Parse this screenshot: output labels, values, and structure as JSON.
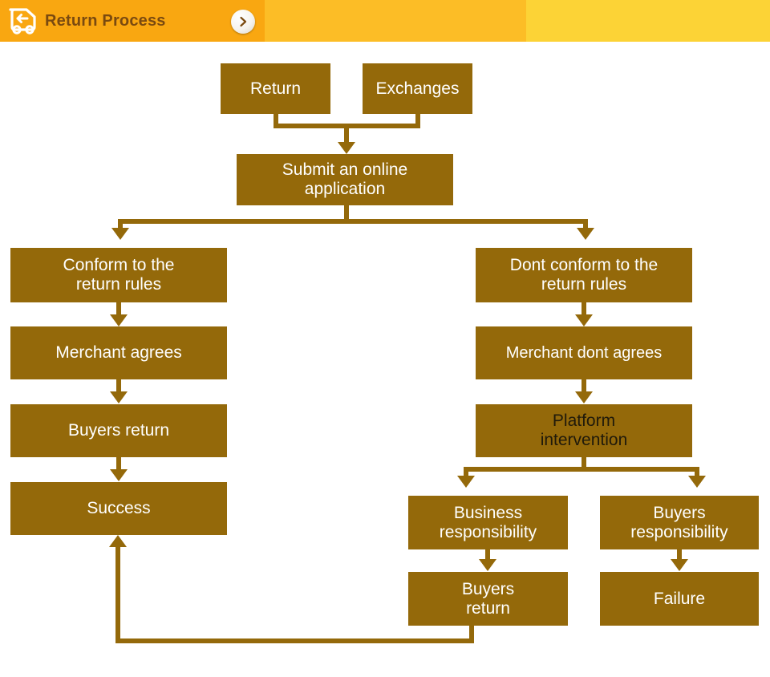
{
  "header": {
    "title": "Return Process",
    "truck_icon": "return-truck-icon",
    "chevron_icon": "chevron-right-icon",
    "band_colors": [
      "#F9A711",
      "#FCBD26",
      "#FCD336"
    ],
    "title_color": "#7A4A10"
  },
  "theme": {
    "node_fill": "#94690A",
    "node_text": "#FFFFFF",
    "node_text_dark": "#201A0A",
    "connector": "#94690A",
    "background": "#FFFFFF"
  },
  "flow": {
    "nodes": [
      {
        "id": "return",
        "label": "Return"
      },
      {
        "id": "exchanges",
        "label": "Exchanges"
      },
      {
        "id": "submit",
        "label": "Submit an online\napplication"
      },
      {
        "id": "conform",
        "label": "Conform to the\nreturn rules"
      },
      {
        "id": "merchant-agrees",
        "label": "Merchant agrees"
      },
      {
        "id": "buyers-return-left",
        "label": "Buyers return"
      },
      {
        "id": "success",
        "label": "Success"
      },
      {
        "id": "dont-conform",
        "label": "Dont conform to the\nreturn rules"
      },
      {
        "id": "merchant-dont-agrees",
        "label": "Merchant dont agrees"
      },
      {
        "id": "platform-intervention",
        "label": "Platform\nintervention"
      },
      {
        "id": "business-responsibility",
        "label": "Business\nresponsibility"
      },
      {
        "id": "buyers-responsibility",
        "label": "Buyers\nresponsibility"
      },
      {
        "id": "buyers-return-right",
        "label": "Buyers\nreturn"
      },
      {
        "id": "failure",
        "label": "Failure"
      }
    ],
    "edges": [
      {
        "from": "return",
        "to": "submit"
      },
      {
        "from": "exchanges",
        "to": "submit"
      },
      {
        "from": "submit",
        "to": "conform"
      },
      {
        "from": "submit",
        "to": "dont-conform"
      },
      {
        "from": "conform",
        "to": "merchant-agrees"
      },
      {
        "from": "merchant-agrees",
        "to": "buyers-return-left"
      },
      {
        "from": "buyers-return-left",
        "to": "success"
      },
      {
        "from": "dont-conform",
        "to": "merchant-dont-agrees"
      },
      {
        "from": "merchant-dont-agrees",
        "to": "platform-intervention"
      },
      {
        "from": "platform-intervention",
        "to": "business-responsibility"
      },
      {
        "from": "platform-intervention",
        "to": "buyers-responsibility"
      },
      {
        "from": "business-responsibility",
        "to": "buyers-return-right"
      },
      {
        "from": "buyers-responsibility",
        "to": "failure"
      },
      {
        "from": "buyers-return-right",
        "to": "success"
      }
    ]
  }
}
